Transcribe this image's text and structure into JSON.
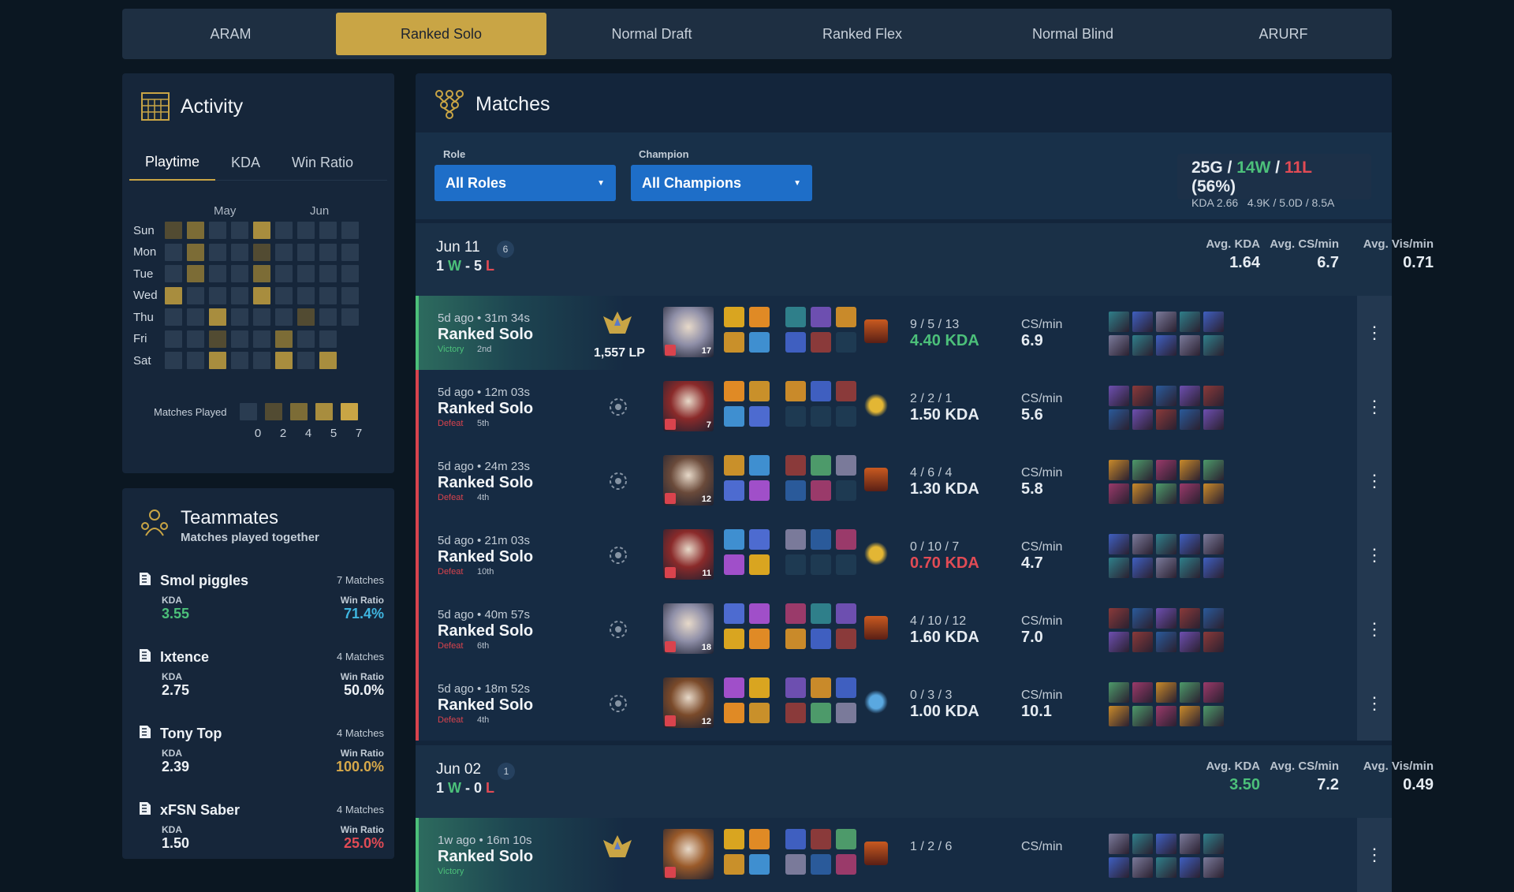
{
  "queue_tabs": [
    "ARAM",
    "Ranked Solo",
    "Normal Draft",
    "Ranked Flex",
    "Normal Blind",
    "ARURF"
  ],
  "active_queue": 1,
  "activity": {
    "title": "Activity",
    "tabs": [
      "Playtime",
      "KDA",
      "Win Ratio"
    ],
    "months": [
      "May",
      "Jun"
    ],
    "days": [
      "Sun",
      "Mon",
      "Tue",
      "Wed",
      "Thu",
      "Fri",
      "Sat"
    ],
    "grid": [
      [
        1,
        2,
        0,
        0,
        3,
        0,
        0,
        0,
        0
      ],
      [
        0,
        2,
        0,
        0,
        1,
        0,
        0,
        0,
        0
      ],
      [
        0,
        2,
        0,
        0,
        2,
        0,
        0,
        0,
        0
      ],
      [
        3,
        0,
        0,
        0,
        3,
        0,
        0,
        0,
        0
      ],
      [
        0,
        0,
        3,
        0,
        0,
        0,
        1,
        0,
        0
      ],
      [
        0,
        0,
        1,
        0,
        0,
        2,
        0,
        0,
        -1
      ],
      [
        0,
        0,
        3,
        0,
        0,
        3,
        0,
        3,
        -1
      ]
    ],
    "legend_label": "Matches Played",
    "legend_nums": [
      "0",
      "2",
      "4",
      "5",
      "7"
    ]
  },
  "teammates": {
    "title": "Teammates",
    "subtitle": "Matches played together",
    "kda_label": "KDA",
    "wr_label": "Win Ratio",
    "list": [
      {
        "name": "Smol piggles",
        "count": "7 Matches",
        "kda": "3.55",
        "wr": "71.4%",
        "kda_color": "green",
        "wr_color": "cyan"
      },
      {
        "name": "Ixtence",
        "count": "4 Matches",
        "kda": "2.75",
        "wr": "50.0%",
        "kda_color": "white",
        "wr_color": "white"
      },
      {
        "name": "Tony Top",
        "count": "4 Matches",
        "kda": "2.39",
        "wr": "100.0%",
        "kda_color": "white",
        "wr_color": "yellow"
      },
      {
        "name": "xFSN Saber",
        "count": "4 Matches",
        "kda": "1.50",
        "wr": "25.0%",
        "kda_color": "white",
        "wr_color": "red"
      }
    ]
  },
  "matches": {
    "title": "Matches",
    "role_label": "Role",
    "role_value": "All Roles",
    "champ_label": "Champion",
    "champ_value": "All Champions",
    "summary": {
      "games": "25G",
      "wins": "14W",
      "losses": "11L",
      "pct": "(56%)",
      "line2": "KDA 2.66   4.9K / 5.0D / 8.5A"
    },
    "stat_labels": [
      "Avg. KDA",
      "Avg. CS/min",
      "Avg. Vis/min"
    ],
    "days": [
      {
        "date": "Jun 11",
        "badge": "6",
        "w": "1",
        "l": "5",
        "kda": "1.64",
        "cs": "6.7",
        "vis": "0.71",
        "kda_color": "white"
      },
      {
        "date": "Jun 02",
        "badge": "1",
        "w": "1",
        "l": "0",
        "kda": "3.50",
        "cs": "7.2",
        "vis": "0.49",
        "kda_color": "green"
      }
    ],
    "games": [
      {
        "when": "5d ago • 31m 34s",
        "queue": "Ranked Solo",
        "result": "Victory",
        "place": "2nd",
        "win": true,
        "lp": "1,557 LP",
        "level": "17",
        "kda_nums": "9 / 5 / 13",
        "kda": "4.40 KDA",
        "kda_color": "green",
        "cs_label": "CS/min",
        "cs": "6.9",
        "champ": "#8f8fa8"
      },
      {
        "when": "5d ago • 12m 03s",
        "queue": "Ranked Solo",
        "result": "Defeat",
        "place": "5th",
        "win": false,
        "lp": "",
        "level": "7",
        "kda_nums": "2 / 2 / 1",
        "kda": "1.50 KDA",
        "kda_color": "white",
        "cs_label": "CS/min",
        "cs": "5.6",
        "champ": "#8a2a2a"
      },
      {
        "when": "5d ago • 24m 23s",
        "queue": "Ranked Solo",
        "result": "Defeat",
        "place": "4th",
        "win": false,
        "lp": "",
        "level": "12",
        "kda_nums": "4 / 6 / 4",
        "kda": "1.30 KDA",
        "kda_color": "white",
        "cs_label": "CS/min",
        "cs": "5.8",
        "champ": "#6a4a3a"
      },
      {
        "when": "5d ago • 21m 03s",
        "queue": "Ranked Solo",
        "result": "Defeat",
        "place": "10th",
        "win": false,
        "lp": "",
        "level": "11",
        "kda_nums": "0 / 10 / 7",
        "kda": "0.70 KDA",
        "kda_color": "red",
        "cs_label": "CS/min",
        "cs": "4.7",
        "champ": "#8a2a2a"
      },
      {
        "when": "5d ago • 40m 57s",
        "queue": "Ranked Solo",
        "result": "Defeat",
        "place": "6th",
        "win": false,
        "lp": "",
        "level": "18",
        "kda_nums": "4 / 10 / 12",
        "kda": "1.60 KDA",
        "kda_color": "white",
        "cs_label": "CS/min",
        "cs": "7.0",
        "champ": "#8f8fa8"
      },
      {
        "when": "5d ago • 18m 52s",
        "queue": "Ranked Solo",
        "result": "Defeat",
        "place": "4th",
        "win": false,
        "lp": "",
        "level": "12",
        "kda_nums": "0 / 3 / 3",
        "kda": "1.00 KDA",
        "kda_color": "white",
        "cs_label": "CS/min",
        "cs": "10.1",
        "champ": "#7a4a2a"
      },
      {
        "when": "1w ago • 16m 10s",
        "queue": "Ranked Solo",
        "result": "Victory",
        "place": "",
        "win": true,
        "lp": "",
        "level": "",
        "kda_nums": "1 / 2 / 6",
        "kda": "",
        "kda_color": "white",
        "cs_label": "CS/min",
        "cs": "",
        "champ": "#9a5a2a"
      }
    ]
  },
  "colors": {
    "gold": "#c9a545",
    "green": "#4cc07a",
    "red": "#e24b55",
    "blue": "#1e6ec8"
  }
}
